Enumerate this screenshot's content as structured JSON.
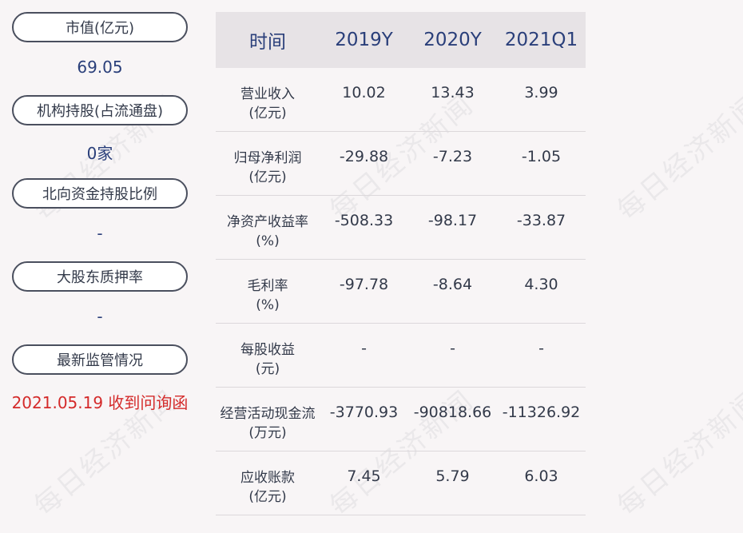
{
  "left_panel": {
    "items": [
      {
        "label": "市值(亿元)",
        "value": "69.05",
        "red": false
      },
      {
        "label": "机构持股(占流通盘)",
        "value": "0家",
        "red": false
      },
      {
        "label": "北向资金持股比例",
        "value": "-",
        "red": false
      },
      {
        "label": "大股东质押率",
        "value": "-",
        "red": false
      },
      {
        "label": "最新监管情况",
        "value": "2021.05.19 收到问询函",
        "red": true
      }
    ]
  },
  "table": {
    "headers": [
      "时间",
      "2019Y",
      "2020Y",
      "2021Q1"
    ],
    "rows": [
      {
        "label": [
          "营业收入",
          "(亿元)"
        ],
        "values": [
          "10.02",
          "13.43",
          "3.99"
        ]
      },
      {
        "label": [
          "归母净利润",
          "(亿元)"
        ],
        "values": [
          "-29.88",
          "-7.23",
          "-1.05"
        ]
      },
      {
        "label": [
          "净资产收益率",
          "(%)"
        ],
        "values": [
          "-508.33",
          "-98.17",
          "-33.87"
        ]
      },
      {
        "label": [
          "毛利率",
          "(%)"
        ],
        "values": [
          "-97.78",
          "-8.64",
          "4.30"
        ]
      },
      {
        "label": [
          "每股收益",
          "(元)"
        ],
        "values": [
          "-",
          "-",
          "-"
        ]
      },
      {
        "label": [
          "经营活动现金流",
          "(万元)"
        ],
        "values": [
          "-3770.93",
          "-90818.66",
          "-11326.92"
        ]
      },
      {
        "label": [
          "应收账款",
          "(亿元)"
        ],
        "values": [
          "7.45",
          "5.79",
          "6.03"
        ]
      }
    ]
  },
  "watermark": "每日经济新闻",
  "colors": {
    "background": "#f8f5f6",
    "header_bg": "#e7e3e6",
    "accent_blue": "#2a3f7a",
    "alert_red": "#d42a2a"
  }
}
